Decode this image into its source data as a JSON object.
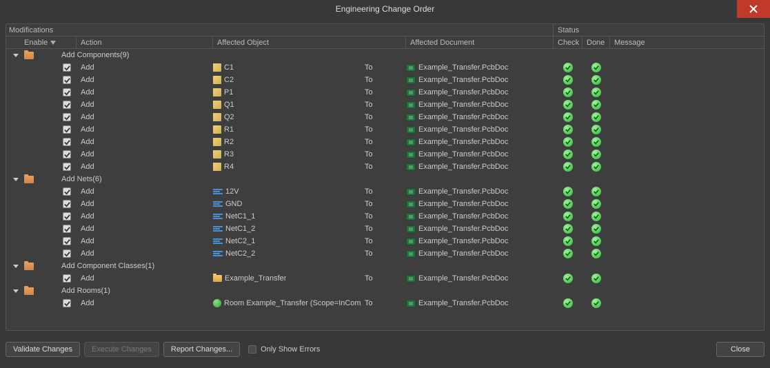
{
  "window": {
    "title": "Engineering Change Order"
  },
  "section_headers": {
    "modifications": "Modifications",
    "status": "Status"
  },
  "columns": {
    "enable": "Enable",
    "action": "Action",
    "affected_object": "Affected Object",
    "affected_document": "Affected Document",
    "check": "Check",
    "done": "Done",
    "message": "Message"
  },
  "groups": [
    {
      "label": "Add Components(9)",
      "items": [
        {
          "enabled": true,
          "action": "Add",
          "icon": "comp",
          "object": "C1",
          "to": "To",
          "docicon": "pcb",
          "document": "Example_Transfer.PcbDoc",
          "check": true,
          "done": true
        },
        {
          "enabled": true,
          "action": "Add",
          "icon": "comp",
          "object": "C2",
          "to": "To",
          "docicon": "pcb",
          "document": "Example_Transfer.PcbDoc",
          "check": true,
          "done": true
        },
        {
          "enabled": true,
          "action": "Add",
          "icon": "comp",
          "object": "P1",
          "to": "To",
          "docicon": "pcb",
          "document": "Example_Transfer.PcbDoc",
          "check": true,
          "done": true
        },
        {
          "enabled": true,
          "action": "Add",
          "icon": "comp",
          "object": "Q1",
          "to": "To",
          "docicon": "pcb",
          "document": "Example_Transfer.PcbDoc",
          "check": true,
          "done": true
        },
        {
          "enabled": true,
          "action": "Add",
          "icon": "comp",
          "object": "Q2",
          "to": "To",
          "docicon": "pcb",
          "document": "Example_Transfer.PcbDoc",
          "check": true,
          "done": true
        },
        {
          "enabled": true,
          "action": "Add",
          "icon": "comp",
          "object": "R1",
          "to": "To",
          "docicon": "pcb",
          "document": "Example_Transfer.PcbDoc",
          "check": true,
          "done": true
        },
        {
          "enabled": true,
          "action": "Add",
          "icon": "comp",
          "object": "R2",
          "to": "To",
          "docicon": "pcb",
          "document": "Example_Transfer.PcbDoc",
          "check": true,
          "done": true
        },
        {
          "enabled": true,
          "action": "Add",
          "icon": "comp",
          "object": "R3",
          "to": "To",
          "docicon": "pcb",
          "document": "Example_Transfer.PcbDoc",
          "check": true,
          "done": true
        },
        {
          "enabled": true,
          "action": "Add",
          "icon": "comp",
          "object": "R4",
          "to": "To",
          "docicon": "pcb",
          "document": "Example_Transfer.PcbDoc",
          "check": true,
          "done": true
        }
      ]
    },
    {
      "label": "Add Nets(6)",
      "items": [
        {
          "enabled": true,
          "action": "Add",
          "icon": "net",
          "object": "12V",
          "to": "To",
          "docicon": "pcb",
          "document": "Example_Transfer.PcbDoc",
          "check": true,
          "done": true
        },
        {
          "enabled": true,
          "action": "Add",
          "icon": "net",
          "object": "GND",
          "to": "To",
          "docicon": "pcb",
          "document": "Example_Transfer.PcbDoc",
          "check": true,
          "done": true
        },
        {
          "enabled": true,
          "action": "Add",
          "icon": "net",
          "object": "NetC1_1",
          "to": "To",
          "docicon": "pcb",
          "document": "Example_Transfer.PcbDoc",
          "check": true,
          "done": true
        },
        {
          "enabled": true,
          "action": "Add",
          "icon": "net",
          "object": "NetC1_2",
          "to": "To",
          "docicon": "pcb",
          "document": "Example_Transfer.PcbDoc",
          "check": true,
          "done": true
        },
        {
          "enabled": true,
          "action": "Add",
          "icon": "net",
          "object": "NetC2_1",
          "to": "To",
          "docicon": "pcb",
          "document": "Example_Transfer.PcbDoc",
          "check": true,
          "done": true
        },
        {
          "enabled": true,
          "action": "Add",
          "icon": "net",
          "object": "NetC2_2",
          "to": "To",
          "docicon": "pcb",
          "document": "Example_Transfer.PcbDoc",
          "check": true,
          "done": true
        }
      ]
    },
    {
      "label": "Add Component Classes(1)",
      "items": [
        {
          "enabled": true,
          "action": "Add",
          "icon": "class",
          "object": "Example_Transfer",
          "to": "To",
          "docicon": "pcb",
          "document": "Example_Transfer.PcbDoc",
          "check": true,
          "done": true
        }
      ]
    },
    {
      "label": "Add Rooms(1)",
      "items": [
        {
          "enabled": true,
          "action": "Add",
          "icon": "room",
          "object": "Room Example_Transfer (Scope=InCom",
          "to": "To",
          "docicon": "pcb",
          "document": "Example_Transfer.PcbDoc",
          "check": true,
          "done": true
        }
      ]
    }
  ],
  "footer": {
    "validate": "Validate Changes",
    "execute": "Execute Changes",
    "report": "Report Changes...",
    "only_errors": "Only Show Errors",
    "close": "Close"
  }
}
